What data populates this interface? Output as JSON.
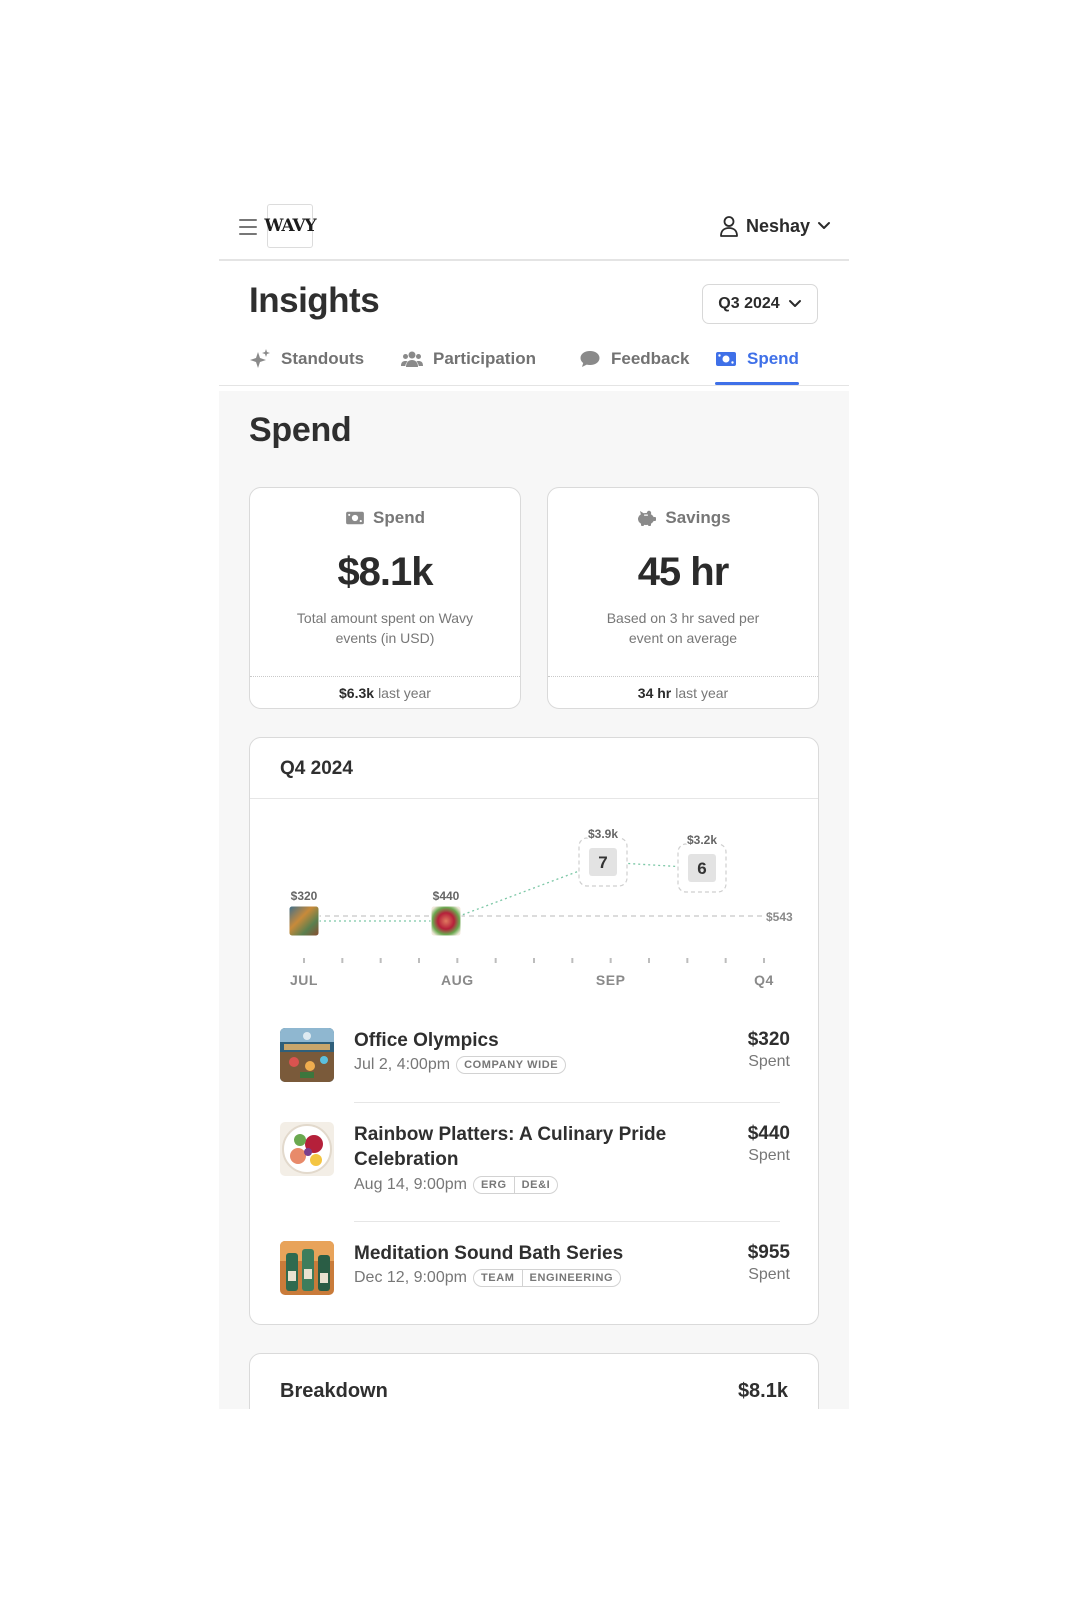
{
  "header": {
    "logo_text": "WAVY",
    "user_name": "Neshay"
  },
  "page": {
    "title": "Insights",
    "quarter_select": "Q3 2024"
  },
  "tabs": [
    {
      "label": "Standouts",
      "icon": "sparkle-icon",
      "active": false
    },
    {
      "label": "Participation",
      "icon": "people-icon",
      "active": false
    },
    {
      "label": "Feedback",
      "icon": "chat-bubble-icon",
      "active": false
    },
    {
      "label": "Spend",
      "icon": "money-icon",
      "active": true
    }
  ],
  "section_title": "Spend",
  "stats": {
    "spend": {
      "label": "Spend",
      "icon": "money-icon",
      "value": "$8.1k",
      "description": "Total amount spent on Wavy events (in USD)",
      "last_year_value": "$6.3k",
      "last_year_label": "last year"
    },
    "savings": {
      "label": "Savings",
      "icon": "piggy-bank-icon",
      "value": "45 hr",
      "description": "Based on 3 hr saved per event on average",
      "last_year_value": "34 hr",
      "last_year_label": "last year"
    }
  },
  "chart_card": {
    "title": "Q4 2024"
  },
  "chart_data": {
    "type": "scatter",
    "x_ticks": [
      "JUL",
      "AUG",
      "SEP",
      "Q4"
    ],
    "points": [
      {
        "period": "JUL",
        "value_label": "$320",
        "kind": "image",
        "thumb": "office-olympics"
      },
      {
        "period": "AUG",
        "value_label": "$440",
        "kind": "image",
        "thumb": "rainbow-platters"
      },
      {
        "period": "SEP",
        "value_label": "$3.9k",
        "kind": "count",
        "count": "7"
      },
      {
        "period": "SEP-OCT",
        "value_label": "$3.2k",
        "kind": "count",
        "count": "6"
      }
    ],
    "reference_line": {
      "label": "$543"
    },
    "accent_color": "#7cc7a6"
  },
  "events": [
    {
      "name": "Office Olympics",
      "date": "Jul 2, 4:00pm",
      "tags": [
        "COMPANY WIDE"
      ],
      "amount": "$320",
      "amount_label": "Spent"
    },
    {
      "name": "Rainbow Platters: A Culinary Pride Celebration",
      "date": "Aug 14, 9:00pm",
      "tags": [
        "ERG",
        "DE&I"
      ],
      "amount": "$440",
      "amount_label": "Spent"
    },
    {
      "name": "Meditation Sound Bath Series",
      "date": "Dec 12, 9:00pm",
      "tags": [
        "TEAM",
        "ENGINEERING"
      ],
      "amount": "$955",
      "amount_label": "Spent"
    }
  ],
  "breakdown": {
    "title": "Breakdown",
    "total": "$8.1k"
  },
  "colors": {
    "accent": "#3f70e8",
    "text": "#2f2f2f",
    "muted": "#777777"
  }
}
